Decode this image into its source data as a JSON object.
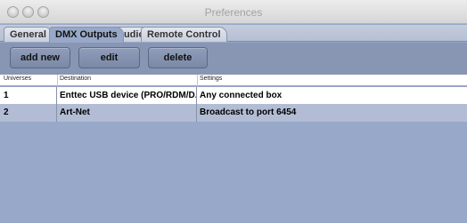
{
  "window": {
    "title": "Preferences"
  },
  "tabs": [
    {
      "label": "General"
    },
    {
      "label": "DMX Outputs"
    },
    {
      "label": "Audio"
    },
    {
      "label": "Remote Control"
    }
  ],
  "active_tab": "DMX Outputs",
  "toolbar": {
    "add_label": "add new",
    "edit_label": "edit",
    "delete_label": "delete"
  },
  "table": {
    "headers": [
      "Universes",
      "Destination",
      "Settings"
    ],
    "rows": [
      {
        "universe": "1",
        "destination": "Enttec USB device (PRO/RDM/D...",
        "settings": "Any connected box"
      },
      {
        "universe": "2",
        "destination": "Art-Net",
        "settings": "Broadcast to port 6454"
      }
    ]
  },
  "colors": {
    "background": "#98a8c8",
    "toolbar": "#8896b4",
    "selected_row": "#b2bcd4"
  }
}
